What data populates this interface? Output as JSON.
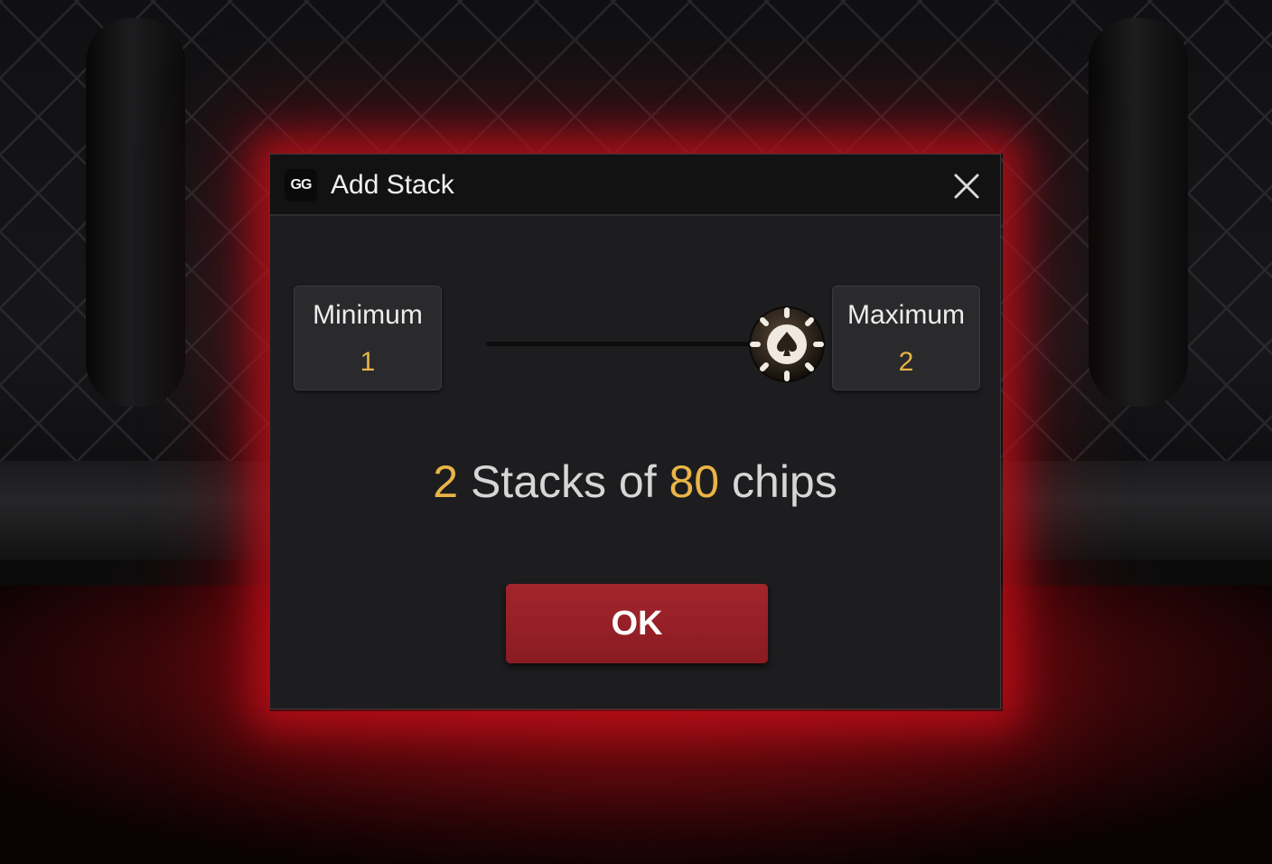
{
  "dialog": {
    "logo_text": "GG",
    "title": "Add Stack",
    "close_icon": "close-icon",
    "minimum": {
      "label": "Minimum",
      "value": "1"
    },
    "maximum": {
      "label": "Maximum",
      "value": "2"
    },
    "slider": {
      "min": 1,
      "max": 2,
      "current": 2,
      "thumb_icon": "poker-chip-spade-icon"
    },
    "summary": {
      "count": "2",
      "middle": " Stacks of ",
      "chips": "80",
      "suffix": " chips"
    },
    "ok_label": "OK"
  },
  "colors": {
    "accent_gold": "#eab446",
    "button_red": "#9a2128",
    "glow_red": "#c80f19",
    "dialog_bg": "#1d1d1f"
  }
}
